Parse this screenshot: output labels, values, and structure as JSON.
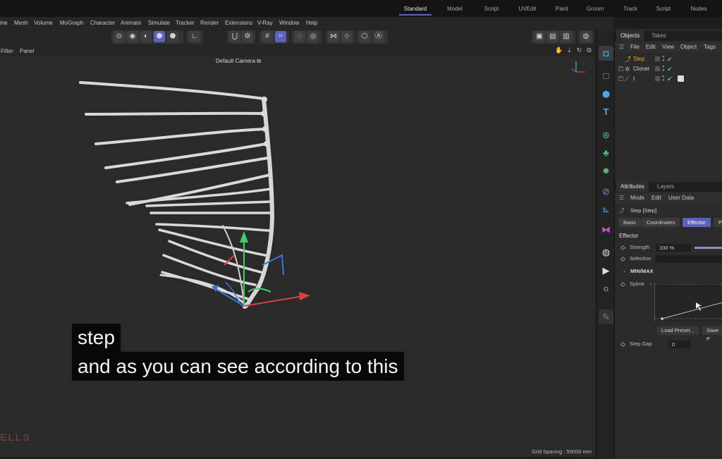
{
  "layout_tabs": [
    "Standard",
    "Model",
    "Script",
    "UVEdit",
    "Paint",
    "Groom",
    "Track",
    "Script",
    "Nodes"
  ],
  "menubar": [
    "ine",
    "Mesh",
    "Volume",
    "MoGraph",
    "Character",
    "Animate",
    "Simulate",
    "Tracker",
    "Render",
    "Extensions",
    "V-Ray",
    "Window",
    "Help"
  ],
  "viewport": {
    "menus": [
      "Filter",
      "Panel"
    ],
    "camera_label": "Default Camera",
    "camera_glyph": "⧉",
    "grid_spacing": "Grid Spacing : 50000 mm",
    "watermark": "ELLS"
  },
  "captions": {
    "line1": "step",
    "line2": "and as you can see according to this"
  },
  "objects_panel": {
    "tabs": [
      "Objects",
      "Takes"
    ],
    "menu": [
      "File",
      "Edit",
      "View",
      "Object",
      "Tags"
    ],
    "rows": [
      {
        "name": "Step",
        "color": "#e8a33a",
        "icon": "step-effector-icon",
        "glyph": "⤴"
      },
      {
        "name": "Cloner",
        "color": "#cfcfcf",
        "icon": "cloner-icon",
        "glyph": "✲"
      },
      {
        "name": "t",
        "color": "#cfcfcf",
        "icon": "spline-icon",
        "glyph": "⟋"
      }
    ],
    "check_glyph": "✔",
    "expand_glyph": "+"
  },
  "attributes_panel": {
    "tabs": [
      "Attributes",
      "Layers"
    ],
    "menu": [
      "Mode",
      "Edit",
      "User Data"
    ],
    "title": "Step [Step]",
    "sub_tabs": [
      "Basic",
      "Coordinates",
      "Effector",
      "Pa"
    ],
    "section": "Effector",
    "strength_label": "Strength",
    "strength_value": "100 %",
    "strength": 1.0,
    "selection_label": "Selection",
    "selection_value": "",
    "minmax_label": "MIN/MAX",
    "spline_label": "Spline",
    "load_preset": "Load Preset...",
    "save_preset": "Save P",
    "step_gap_label": "Step Gap",
    "step_gap_value": "0"
  },
  "colors": {
    "accent": "#5a63b5",
    "step_object": "#e8a33a",
    "check_green": "#55d06e"
  }
}
